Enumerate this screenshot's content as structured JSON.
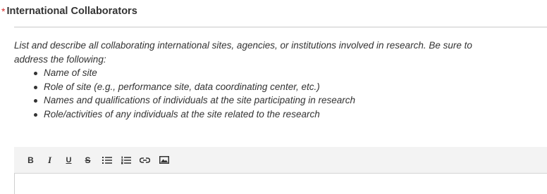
{
  "field": {
    "required_marker": "*",
    "title": "International Collaborators"
  },
  "instructions": {
    "intro": "List and describe all collaborating international sites, agencies, or institutions involved in research. Be sure to",
    "intro_cont": "address the following:",
    "items": [
      "Name of site",
      "Role of site (e.g., performance site, data coordinating center, etc.)",
      "Names and qualifications of individuals at the site participating in research",
      "Role/activities of any individuals at the site related to the research"
    ]
  },
  "toolbar": {
    "buttons": [
      {
        "icon": "bold-icon",
        "glyph": "B"
      },
      {
        "icon": "italic-icon",
        "glyph": "I"
      },
      {
        "icon": "underline-icon",
        "glyph": "U"
      },
      {
        "icon": "strikethrough-icon",
        "glyph": "S"
      },
      {
        "icon": "bulleted-list-icon",
        "glyph": ""
      },
      {
        "icon": "numbered-list-icon",
        "glyph": ""
      },
      {
        "icon": "link-icon",
        "glyph": ""
      },
      {
        "icon": "image-icon",
        "glyph": ""
      }
    ]
  },
  "editor": {
    "value": ""
  },
  "colors": {
    "required": "#d62b2b",
    "text": "#333333",
    "toolbar_bg": "#f3f3f3"
  }
}
